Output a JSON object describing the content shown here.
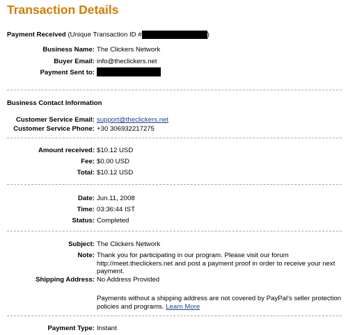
{
  "page_title": "Transaction Details",
  "header": {
    "received_label": "Payment Received",
    "unique_id_label": "(Unique Transaction ID #",
    "unique_id_close": ")"
  },
  "summary": {
    "business_name_label": "Business Name:",
    "business_name_value": "The Clickers Network",
    "buyer_email_label": "Buyer Email:",
    "buyer_email_value": "info@theclickers.net",
    "payment_sent_label": "Payment Sent to:"
  },
  "contact": {
    "heading": "Business Contact Information",
    "cs_email_label": "Customer Service Email:",
    "cs_email_value": "support@theclickers.net",
    "cs_phone_label": "Customer Service Phone:",
    "cs_phone_value": "+30 306932217275"
  },
  "amounts": {
    "received_label": "Amount received:",
    "received_value": "$10.12 USD",
    "fee_label": "Fee:",
    "fee_value": "$0.00 USD",
    "total_label": "Total:",
    "total_value": "$10.12 USD"
  },
  "timing": {
    "date_label": "Date:",
    "date_value": "Jun.11, 2008",
    "time_label": "Time:",
    "time_value": "03:36:44 IST",
    "status_label": "Status:",
    "status_value": "Completed"
  },
  "details": {
    "subject_label": "Subject:",
    "subject_value": "The Clickers Network",
    "note_label": "Note:",
    "note_value": "Thank you for participating in our program. Please visit our forum http://meet.theclickers.net and post a payment proof in order to receive your next payment.",
    "shipping_label": "Shipping Address:",
    "shipping_value": "No Address Provided",
    "shipping_notice": "Payments without a shipping address are not covered by PayPal's seller protection policies and programs.",
    "learn_more": "Learn More"
  },
  "payment_type": {
    "label": "Payment Type:",
    "value": "Instant"
  }
}
